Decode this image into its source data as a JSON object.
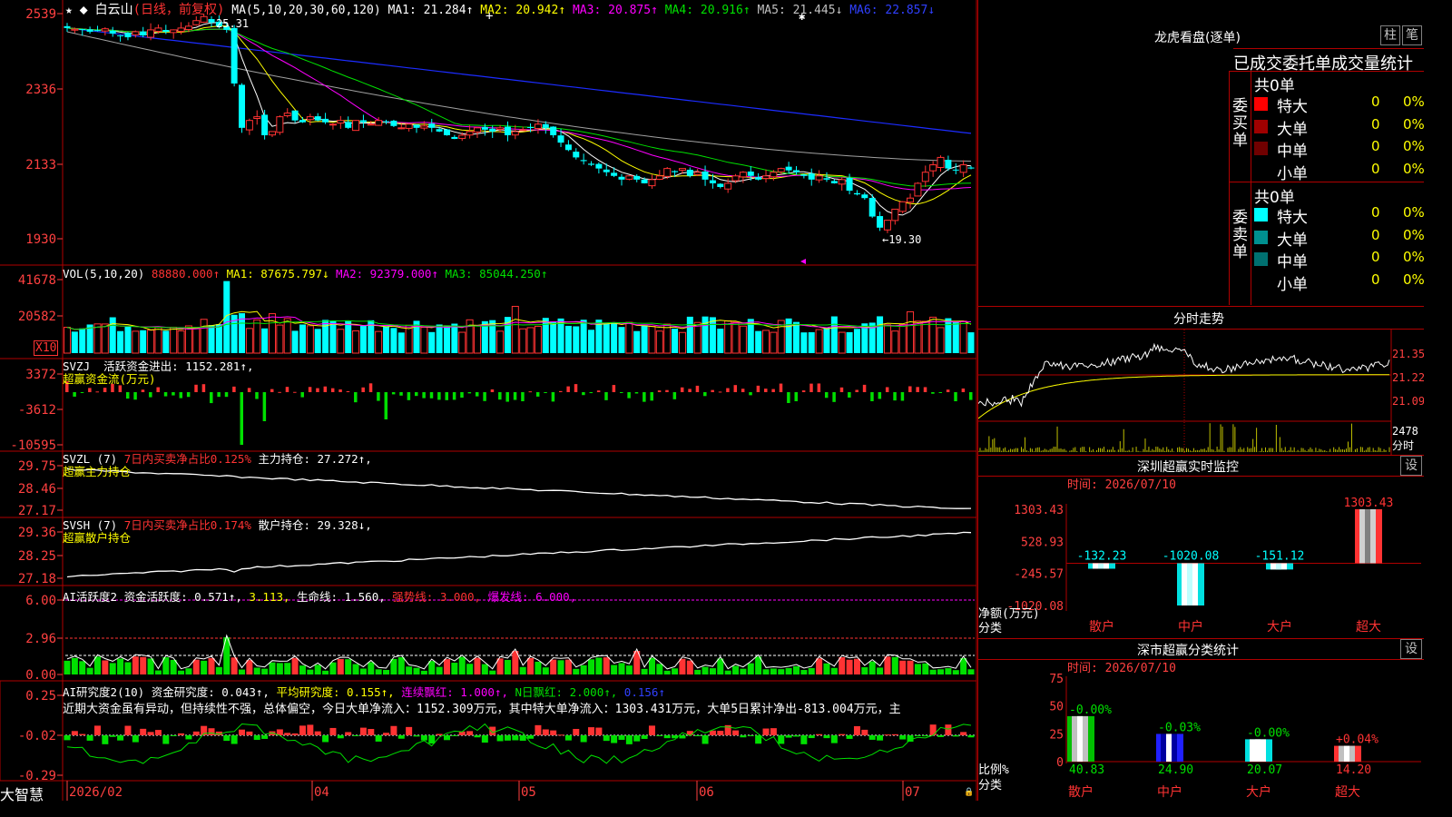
{
  "stock": {
    "name": "白云山",
    "period": "(日线，前复权)"
  },
  "colors": {
    "up": "#ff3333",
    "down": "#00ffff",
    "grid": "#b00000",
    "bg": "#000000",
    "axis_text": "#ff4040",
    "white": "#ffffff",
    "yellow": "#ffff00",
    "magenta": "#ff00ff",
    "green": "#00e000",
    "gray": "#a0a0a0",
    "blue": "#1c2cff"
  },
  "brand": "大智慧",
  "time_axis": [
    "2026/02",
    "04",
    "05",
    "06",
    "07"
  ],
  "price_panel": {
    "ma_label": "MA(5,10,20,30,60,120)",
    "items": [
      {
        "text": "MA1: 21.284↑",
        "color": "#ffffff"
      },
      {
        "text": "MA2: 20.942↑",
        "color": "#ffff00"
      },
      {
        "text": "MA3: 20.875↑",
        "color": "#ff00ff"
      },
      {
        "text": "MA4: 20.916↑",
        "color": "#00e000"
      },
      {
        "text": "MA5: 21.445↓",
        "color": "#c0c0c0"
      },
      {
        "text": "MA6: 22.857↓",
        "color": "#3040ff"
      }
    ],
    "y_ticks": [
      "2539",
      "2336",
      "2133",
      "1930"
    ],
    "y_range": [
      18.9,
      25.5
    ],
    "high_marker": "25.31",
    "low_marker": "←19.30"
  },
  "vol_panel": {
    "label": "VOL(5,10,20)",
    "value": "88880.000↑",
    "items": [
      {
        "text": "MA1: 87675.797↓",
        "color": "#ffff00"
      },
      {
        "text": "MA2: 92379.000↑",
        "color": "#ff00ff"
      },
      {
        "text": "MA3: 85044.250↑",
        "color": "#00e000"
      }
    ],
    "y_ticks": [
      "41678",
      "20582"
    ],
    "unit": "X10"
  },
  "svzj_panel": {
    "label": "SVZJ",
    "desc": "活跃资金进出: 1152.281↑,",
    "sub": "超赢资金流(万元)",
    "y_ticks": [
      "3372",
      "-3612",
      "-10595"
    ]
  },
  "svzl_panel": {
    "label": "SVZL (7)",
    "item1": "7日内买卖净占比0.125%",
    "item2": "主力持仓: 27.272↑,",
    "sub": "超赢主力持仓",
    "y_ticks": [
      "29.75",
      "28.46",
      "27.17"
    ]
  },
  "svsh_panel": {
    "label": "SVSH (7)",
    "item1": "7日内买卖净占比0.174%",
    "item2": "散户持仓: 29.328↓,",
    "sub": "超赢散户持仓",
    "y_ticks": [
      "29.36",
      "28.25",
      "27.18"
    ]
  },
  "ai_active_panel": {
    "label": "AI活跃度2",
    "items": [
      {
        "text": "资金活跃度: 0.571↑,",
        "color": "#ffffff"
      },
      {
        "text": "3.113,",
        "color": "#ffff00"
      },
      {
        "text": "生命线: 1.560,",
        "color": "#ffffff"
      },
      {
        "text": "强势线: 3.000,",
        "color": "#ff3333"
      },
      {
        "text": "爆发线: 6.000,",
        "color": "#ff00ff"
      }
    ],
    "y_ticks": [
      "6.00",
      "2.96",
      "0.00"
    ]
  },
  "ai_research_panel": {
    "label": "AI研究度2(10)",
    "items": [
      {
        "text": "资金研究度: 0.043↑,",
        "color": "#ffffff"
      },
      {
        "text": "平均研究度: 0.155↑,",
        "color": "#ffff00"
      },
      {
        "text": "连续飘红: 1.000↑,",
        "color": "#ff00ff"
      },
      {
        "text": "N日飘红: 2.000↑,",
        "color": "#00e000"
      },
      {
        "text": "0.156↑",
        "color": "#3040ff"
      }
    ],
    "comment": "近期大资金虽有异动，但持续性不强，总体偏空，今日大单净流入：1152.309万元，其中特大单净流入：1303.431万元，大单5日累计净出-813.004万元，主",
    "y_ticks": [
      "0.25",
      "-0.02",
      "-0.29"
    ]
  },
  "right_top": {
    "title": "龙虎看盘(逐单)",
    "btn1": "柱",
    "btn2": "笔",
    "tabs": "已成交委托单成交量统计",
    "buy_side": "委买单",
    "sell_side": "委卖单",
    "buy_total": "共0单",
    "sell_total": "共0单",
    "buy_rows": [
      {
        "label": "特大",
        "color": "#ff0000",
        "count": "0",
        "pct": "0%"
      },
      {
        "label": "大单",
        "color": "#a00000",
        "count": "0",
        "pct": "0%"
      },
      {
        "label": "中单",
        "color": "#700000",
        "count": "0",
        "pct": "0%"
      },
      {
        "label": "小单",
        "color": "#000000",
        "count": "0",
        "pct": "0%"
      }
    ],
    "sell_rows": [
      {
        "label": "特大",
        "color": "#00ffff",
        "count": "0",
        "pct": "0%"
      },
      {
        "label": "大单",
        "color": "#009090",
        "count": "0",
        "pct": "0%"
      },
      {
        "label": "中单",
        "color": "#007070",
        "count": "0",
        "pct": "0%"
      },
      {
        "label": "小单",
        "color": "#000000",
        "count": "0",
        "pct": "0%"
      }
    ]
  },
  "intraday": {
    "title": "分时走势",
    "y_ticks": [
      "21.35",
      "21.22",
      "21.09"
    ],
    "vol_label": "2478",
    "vol_unit": "分时"
  },
  "sz_monitor": {
    "title": "深圳超赢实时监控",
    "set_btn": "设",
    "time": "时间: 2026/07/10",
    "y_ticks": [
      "1303.43",
      "528.93",
      "-245.57",
      "-1020.08"
    ],
    "ylabel": "净额(万元)",
    "xlabel": "分类",
    "chart_data": {
      "type": "bar",
      "categories": [
        "散户",
        "中户",
        "大户",
        "超大"
      ],
      "values": [
        -132.23,
        -1020.08,
        -151.12,
        1303.43
      ],
      "value_labels": [
        "-132.23",
        "-1020.08",
        "-151.12",
        "1303.43"
      ],
      "ylim": [
        -1020.08,
        1303.43
      ]
    }
  },
  "sm_stats": {
    "title": "深市超赢分类统计",
    "set_btn": "设",
    "time": "时间: 2026/07/10",
    "y_ticks": [
      "75",
      "50",
      "25",
      "0"
    ],
    "ylabel": "比例%",
    "xlabel": "分类",
    "chart_data": {
      "type": "bar",
      "categories": [
        "散户",
        "中户",
        "大户",
        "超大"
      ],
      "values": [
        40.83,
        24.9,
        20.07,
        14.2
      ],
      "value_labels": [
        "40.83",
        "24.90",
        "20.07",
        "14.20"
      ],
      "change_labels": [
        "-0.00%",
        "-0.03%",
        "-0.00%",
        "+0.04%"
      ],
      "ylim": [
        0,
        75
      ]
    }
  },
  "chart_data": [
    {
      "type": "candlestick",
      "title": "白云山 (日线，前复权)",
      "ylim": [
        18.9,
        25.5
      ],
      "y_ticks": [
        25.39,
        23.36,
        21.33,
        19.3
      ],
      "high": 25.31,
      "low": 19.3,
      "ma_last": {
        "MA1": 21.284,
        "MA2": 20.942,
        "MA3": 20.875,
        "MA4": 20.916,
        "MA5": 21.445,
        "MA6": 22.857
      },
      "closes": [
        25.0,
        24.97,
        24.95,
        24.9,
        24.92,
        24.98,
        24.85,
        24.8,
        24.75,
        24.9,
        24.8,
        24.95,
        25.0,
        24.9,
        24.95,
        25.0,
        25.05,
        25.2,
        25.31,
        25.15,
        25.05,
        24.95,
        23.5,
        22.3,
        22.5,
        22.6,
        22.1,
        22.2,
        22.6,
        22.7,
        22.5,
        22.45,
        22.6,
        22.5,
        22.45,
        22.4,
        22.5,
        22.3,
        22.5,
        22.45,
        22.4,
        22.5,
        22.45,
        22.35,
        22.3,
        22.4,
        22.3,
        22.35,
        22.3,
        22.2,
        22.1,
        22.0,
        22.1,
        22.2,
        22.3,
        22.25,
        22.2,
        22.3,
        22.1,
        22.2,
        22.25,
        22.3,
        22.4,
        22.3,
        22.1,
        21.9,
        21.7,
        21.5,
        21.4,
        21.3,
        21.2,
        21.1,
        21.0,
        20.9,
        21.0,
        20.9,
        20.8,
        20.9,
        21.0,
        21.2,
        21.1,
        21.2,
        21.0,
        21.1,
        20.9,
        20.8,
        20.7,
        20.8,
        21.0,
        21.1,
        21.0,
        20.9,
        21.0,
        21.1,
        21.2,
        21.15,
        21.1,
        21.0,
        20.9,
        21.0,
        20.9,
        20.8,
        20.9,
        20.6,
        20.5,
        20.4,
        19.9,
        19.6,
        19.8,
        20.1,
        20.3,
        20.4,
        20.8,
        21.1,
        21.3,
        21.5,
        21.2,
        21.15,
        21.3,
        21.2
      ]
    },
    {
      "type": "bar",
      "title": "VOL(5,10,20)",
      "ylim": [
        0,
        41678
      ],
      "last": 88880.0
    },
    {
      "type": "bar",
      "title": "SVZJ 活跃资金进出",
      "ylim": [
        -10595,
        3372
      ],
      "last": 1152.281
    },
    {
      "type": "line",
      "title": "SVZL 主力持仓",
      "ylim": [
        27.17,
        29.75
      ],
      "last": 27.272
    },
    {
      "type": "line",
      "title": "SVSH 散户持仓",
      "ylim": [
        27.18,
        29.36
      ],
      "last": 29.328
    },
    {
      "type": "bar",
      "title": "AI活跃度2",
      "ylim": [
        0,
        6.0
      ],
      "last": 0.571
    },
    {
      "type": "bar",
      "title": "AI研究度2(10)",
      "ylim": [
        -0.29,
        0.25
      ],
      "last": 0.043
    }
  ]
}
